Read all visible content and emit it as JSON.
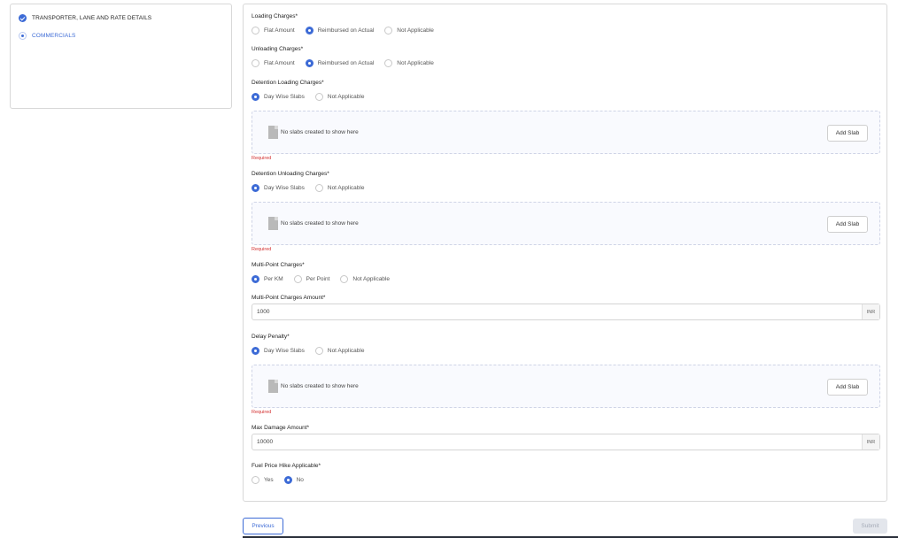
{
  "stepper": {
    "steps": [
      {
        "label": "TRANSPORTER, LANE AND RATE DETAILS",
        "state": "done"
      },
      {
        "label": "COMMERCIALS",
        "state": "active"
      }
    ]
  },
  "form": {
    "loading_charges": {
      "label": "Loading Charges*",
      "options": [
        "Flat Amount",
        "Reimbursed on Actual",
        "Not Applicable"
      ],
      "selected": "Reimbursed on Actual"
    },
    "unloading_charges": {
      "label": "Unloading Charges*",
      "options": [
        "Flat Amount",
        "Reimbursed on Actual",
        "Not Applicable"
      ],
      "selected": "Reimbursed on Actual"
    },
    "detention_loading": {
      "label": "Detention Loading Charges*",
      "options": [
        "Day Wise Slabs",
        "Not Applicable"
      ],
      "selected": "Day Wise Slabs",
      "empty_text": "No slabs created to show here",
      "add_button": "Add Slab",
      "error": "Required"
    },
    "detention_unloading": {
      "label": "Detention Unloading Charges*",
      "options": [
        "Day Wise Slabs",
        "Not Applicable"
      ],
      "selected": "Day Wise Slabs",
      "empty_text": "No slabs created to show here",
      "add_button": "Add Slab",
      "error": "Required"
    },
    "multi_point": {
      "label": "Multi-Point Charges*",
      "options": [
        "Per KM",
        "Per Point",
        "Not Applicable"
      ],
      "selected": "Per KM"
    },
    "multi_point_amount": {
      "label": "Multi-Point Charges Amount*",
      "value": "1000",
      "unit": "INR"
    },
    "delay_penalty": {
      "label": "Delay Penalty*",
      "options": [
        "Day Wise Slabs",
        "Not Applicable"
      ],
      "selected": "Day Wise Slabs",
      "empty_text": "No slabs created to show here",
      "add_button": "Add Slab",
      "error": "Required"
    },
    "max_damage": {
      "label": "Max Damage Amount*",
      "value": "10000",
      "unit": "INR"
    },
    "fuel_hike": {
      "label": "Fuel Price Hike Applicable*",
      "options": [
        "Yes",
        "No"
      ],
      "selected": "No"
    }
  },
  "footer": {
    "previous_label": "Previous",
    "submit_label": "Submit"
  },
  "colors": {
    "accent": "#3d6bd6",
    "error": "#d32f2f"
  }
}
